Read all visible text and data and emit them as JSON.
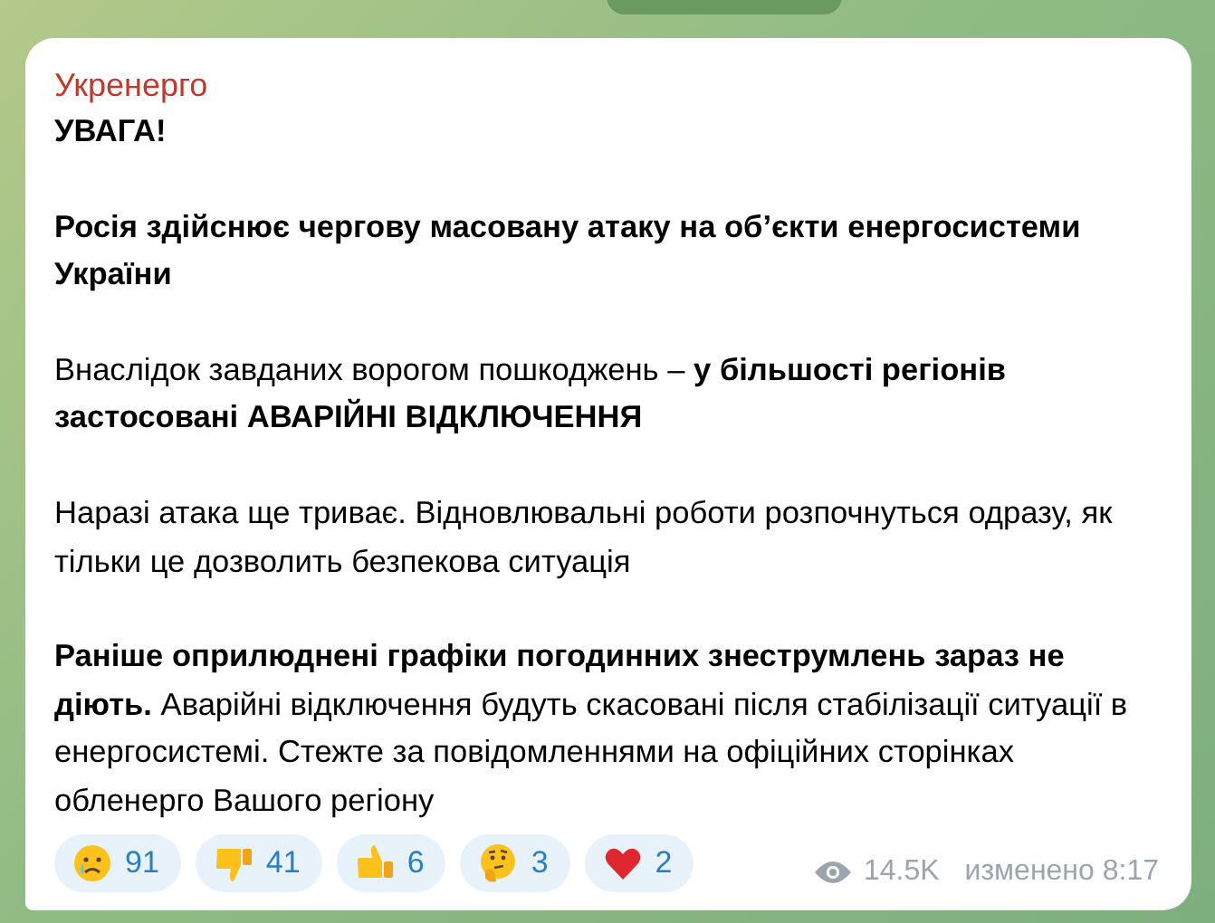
{
  "message": {
    "sender": "Укренерго",
    "paragraphs": [
      {
        "text": "УВАГА!",
        "bold": true
      },
      {
        "text": "Росія здійснює чергову масовану атаку на об’єкти енергосистеми України",
        "bold": true
      },
      {
        "text": "Внаслідок завданих ворогом пошкоджень – **у більшості регіонів застосовані АВАРІЙНІ ВІДКЛЮЧЕННЯ**",
        "bold": false
      },
      {
        "text": "Наразі атака ще триває. Відновлювальні роботи розпочнуться одразу, як тільки це дозволить безпекова ситуація",
        "bold": false
      },
      {
        "text": "**Раніше оприлюднені графіки погодинних знеструмлень зараз не діють.** Аварійні відключення будуть скасовані після стабілізації ситуації в енергосистемі. Стежте за повідомленнями на офіційних сторінках обленерго Вашого регіону",
        "bold": false
      }
    ],
    "reactions": [
      {
        "kind": "cry",
        "count": "91"
      },
      {
        "kind": "thumbs-down",
        "count": "41"
      },
      {
        "kind": "thumbs-up",
        "count": "6"
      },
      {
        "kind": "thinking",
        "count": "3"
      },
      {
        "kind": "heart",
        "count": "2"
      }
    ],
    "views": "14.5K",
    "edited_time": "изменено 8:17"
  }
}
